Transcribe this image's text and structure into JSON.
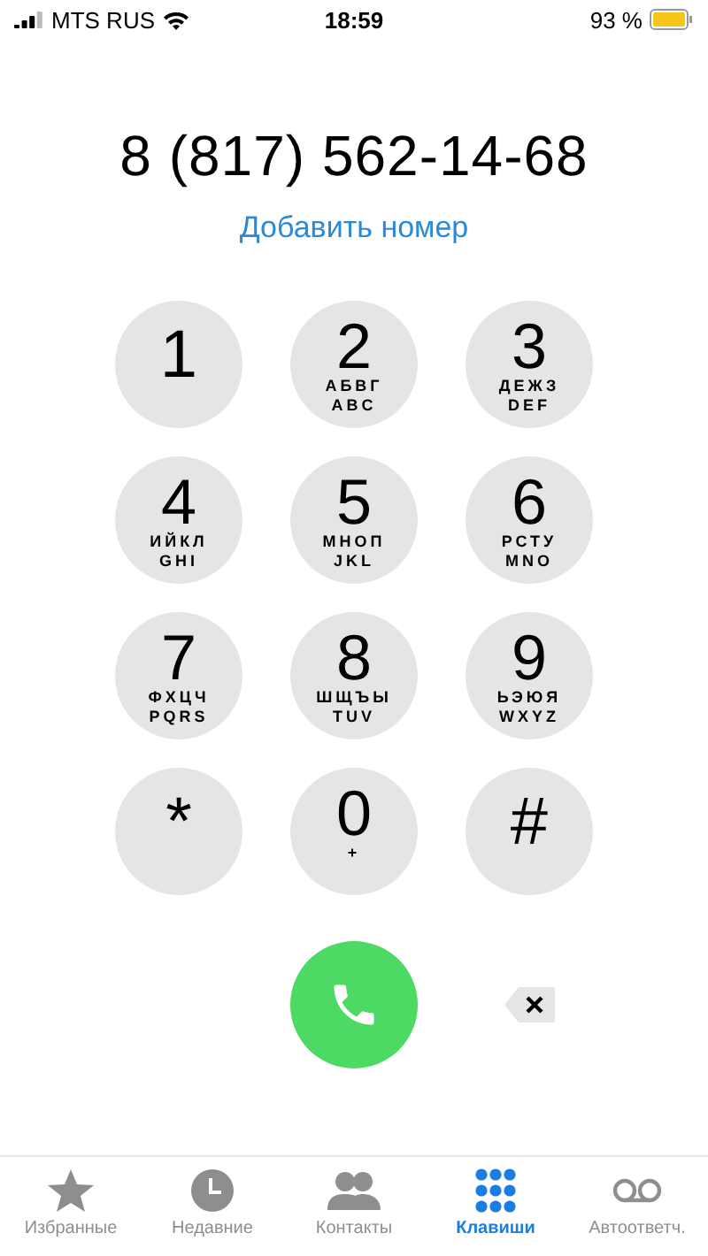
{
  "status_bar": {
    "carrier": "MTS RUS",
    "time": "18:59",
    "battery": "93 %"
  },
  "number": "8 (817) 562-14-68",
  "add_number": "Добавить номер",
  "keys": [
    {
      "digit": "1"
    },
    {
      "digit": "2",
      "letters": [
        "АБВГ",
        "ABC"
      ]
    },
    {
      "digit": "3",
      "letters": [
        "ДЕЖЗ",
        "DEF"
      ]
    },
    {
      "digit": "4",
      "letters": [
        "ИЙКЛ",
        "GHI"
      ]
    },
    {
      "digit": "5",
      "letters": [
        "МНОП",
        "JKL"
      ]
    },
    {
      "digit": "6",
      "letters": [
        "РСТУ",
        "MNO"
      ]
    },
    {
      "digit": "7",
      "letters": [
        "ФХЦЧ",
        "PQRS"
      ]
    },
    {
      "digit": "8",
      "letters": [
        "ШЩЪЫ",
        "TUV"
      ]
    },
    {
      "digit": "9",
      "letters": [
        "ЬЭЮЯ",
        "WXYZ"
      ]
    },
    {
      "digit": "*"
    },
    {
      "digit": "0",
      "letters": [
        "+"
      ]
    },
    {
      "digit": "#"
    }
  ],
  "tabs": [
    {
      "label": "Избранные",
      "kind": "favorites",
      "selected": false
    },
    {
      "label": "Недавние",
      "kind": "recents",
      "selected": false
    },
    {
      "label": "Контакты",
      "kind": "contacts",
      "selected": false
    },
    {
      "label": "Клавиши",
      "kind": "keypad",
      "selected": true
    },
    {
      "label": "Автоответч.",
      "kind": "voicemail",
      "selected": false
    }
  ]
}
